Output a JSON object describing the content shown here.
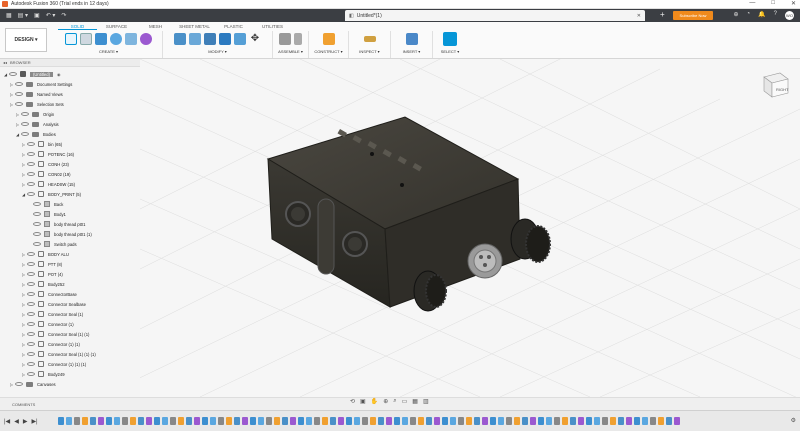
{
  "window": {
    "title": "Autodesk Fusion 360 (Trial ends in 12 days)",
    "controls": [
      "—",
      "□",
      "✕"
    ]
  },
  "doc": {
    "tab_title": "Untitled*(1)"
  },
  "topbar": {
    "subscribe": "Subscribe Now",
    "avatar": "WO"
  },
  "ribbon": {
    "workspace": "DESIGN ▾",
    "tabs": [
      "SOLID",
      "SURFACE",
      "MESH",
      "SHEET METAL",
      "PLASTIC",
      "UTILITIES"
    ],
    "active_tab": "SOLID",
    "groups": [
      {
        "label": "CREATE ▾"
      },
      {
        "label": "MODIFY ▾"
      },
      {
        "label": "ASSEMBLE ▾"
      },
      {
        "label": "CONSTRUCT ▾"
      },
      {
        "label": "INSPECT ▾"
      },
      {
        "label": "INSERT ▾"
      },
      {
        "label": "SELECT ▾"
      }
    ]
  },
  "browser": {
    "header": "BROWSER",
    "root": "(Untitled)",
    "items": [
      {
        "label": "Document Settings",
        "indent": 1,
        "icon": "gear"
      },
      {
        "label": "Named Views",
        "indent": 1,
        "icon": "folder"
      },
      {
        "label": "Selection Sets",
        "indent": 1,
        "icon": "folder"
      },
      {
        "label": "Origin",
        "indent": 2,
        "icon": "folder"
      },
      {
        "label": "Analysis",
        "indent": 2,
        "icon": "folder"
      },
      {
        "label": "Bodies",
        "indent": 2,
        "icon": "folder"
      },
      {
        "label": "bin (65)",
        "indent": 3,
        "icon": "comp"
      },
      {
        "label": "POTENC (16)",
        "indent": 3,
        "icon": "comp"
      },
      {
        "label": "CONH (23)",
        "indent": 3,
        "icon": "comp"
      },
      {
        "label": "CON02 (19)",
        "indent": 3,
        "icon": "comp"
      },
      {
        "label": "HEADSW (15)",
        "indent": 3,
        "icon": "comp"
      },
      {
        "label": "BODY_PRINT (5)",
        "indent": 3,
        "icon": "comp"
      },
      {
        "label": "Back",
        "indent": 4,
        "icon": "body"
      },
      {
        "label": "Body1",
        "indent": 4,
        "icon": "body"
      },
      {
        "label": "body thread pt01",
        "indent": 4,
        "icon": "body"
      },
      {
        "label": "body thread pt01 (1)",
        "indent": 4,
        "icon": "body"
      },
      {
        "label": "Switch pads",
        "indent": 4,
        "icon": "body"
      },
      {
        "label": "BODY ALU",
        "indent": 3,
        "icon": "comp"
      },
      {
        "label": "PTT (8)",
        "indent": 3,
        "icon": "comp"
      },
      {
        "label": "POT (4)",
        "indent": 3,
        "icon": "comp"
      },
      {
        "label": "Body252",
        "indent": 3,
        "icon": "comp"
      },
      {
        "label": "ConnectorBase",
        "indent": 3,
        "icon": "comp"
      },
      {
        "label": "Connector Sealbase",
        "indent": 3,
        "icon": "comp"
      },
      {
        "label": "Connector Seal (1)",
        "indent": 3,
        "icon": "comp"
      },
      {
        "label": "Connector (1)",
        "indent": 3,
        "icon": "comp"
      },
      {
        "label": "Connector Seal (1) (1)",
        "indent": 3,
        "icon": "comp"
      },
      {
        "label": "Connector (1) (1)",
        "indent": 3,
        "icon": "comp"
      },
      {
        "label": "Connector Seal (1) (1) (1)",
        "indent": 3,
        "icon": "comp"
      },
      {
        "label": "Connector (1) (1) (1)",
        "indent": 3,
        "icon": "comp"
      },
      {
        "label": "Body249",
        "indent": 3,
        "icon": "comp"
      },
      {
        "label": "Canvases",
        "indent": 1,
        "icon": "folder"
      }
    ]
  },
  "comments": {
    "label": "COMMENTS"
  },
  "viewcube": {
    "face": "RIGHT"
  },
  "colors": {
    "accent": "#0696d7",
    "subscribe": "#f08a1c",
    "topbar": "#3b3e43",
    "model": "#3a3832"
  }
}
